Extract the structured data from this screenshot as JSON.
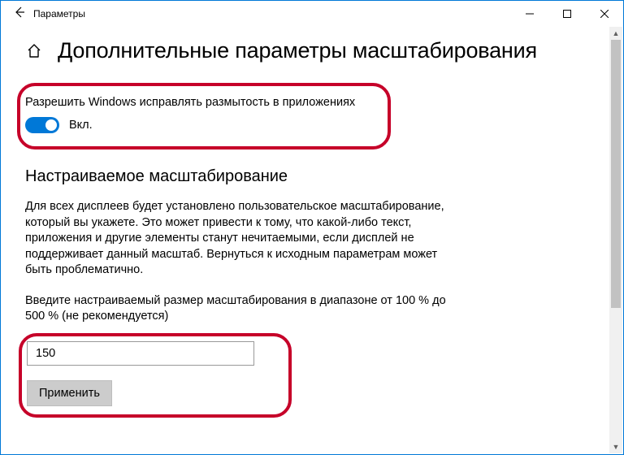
{
  "window": {
    "title": "Параметры"
  },
  "page": {
    "heading": "Дополнительные параметры масштабирования"
  },
  "fix_blur": {
    "label": "Разрешить Windows исправлять размытость в приложениях",
    "state_label": "Вкл.",
    "enabled": true
  },
  "custom_scaling": {
    "heading": "Настраиваемое масштабирование",
    "description": "Для всех дисплеев будет установлено пользовательское масштабирование, который вы укажете. Это может привести к тому, что какой-либо текст, приложения и другие элементы станут нечитаемыми, если дисплей не поддерживает данный масштаб. Вернуться к исходным параметрам может быть проблематично.",
    "input_hint": "Введите настраиваемый размер масштабирования в диапазоне от 100 % до 500 % (не рекомендуется)",
    "input_value": "150",
    "apply_label": "Применить"
  },
  "colors": {
    "accent": "#0078d7",
    "highlight_border": "#c60029"
  }
}
